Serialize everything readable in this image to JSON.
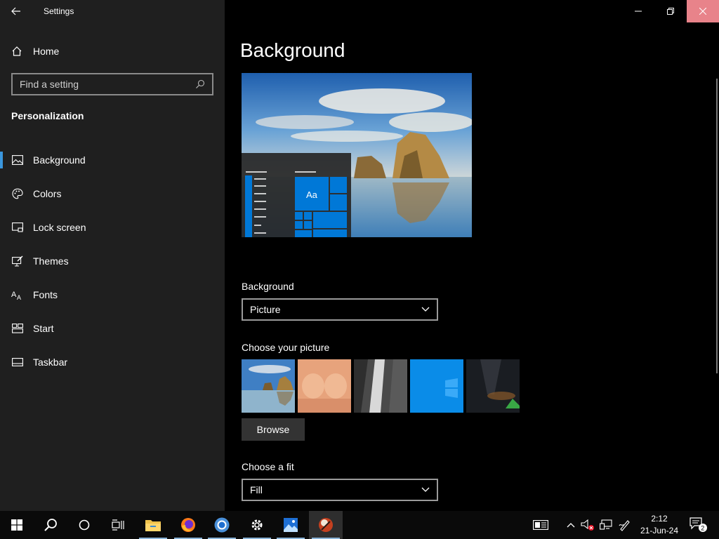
{
  "window": {
    "title": "Settings",
    "controls": [
      "minimize",
      "restore",
      "close"
    ]
  },
  "sidebar": {
    "home_label": "Home",
    "search_placeholder": "Find a setting",
    "section_title": "Personalization",
    "items": [
      {
        "label": "Background",
        "icon": "picture-icon",
        "active": true
      },
      {
        "label": "Colors",
        "icon": "palette-icon",
        "active": false
      },
      {
        "label": "Lock screen",
        "icon": "lock-screen-icon",
        "active": false
      },
      {
        "label": "Themes",
        "icon": "themes-icon",
        "active": false
      },
      {
        "label": "Fonts",
        "icon": "fonts-icon",
        "active": false
      },
      {
        "label": "Start",
        "icon": "start-icon",
        "active": false
      },
      {
        "label": "Taskbar",
        "icon": "taskbar-icon",
        "active": false
      }
    ]
  },
  "main": {
    "page_title": "Background",
    "preview_tile_text": "Aa",
    "background_label": "Background",
    "background_value": "Picture",
    "choose_picture_label": "Choose your picture",
    "pictures": [
      "beach-rock",
      "portrait",
      "waterfall",
      "windows-blue",
      "night-sky"
    ],
    "browse_label": "Browse",
    "fit_label": "Choose a fit",
    "fit_value": "Fill"
  },
  "taskbar": {
    "apps": [
      "start",
      "search",
      "cortana",
      "task-view",
      "file-explorer",
      "firefox",
      "chrome",
      "settings",
      "photos",
      "app"
    ],
    "clock_time": "2:12",
    "clock_date": "21-Jun-24",
    "notification_count": "2"
  },
  "colors": {
    "accent": "#0078d7",
    "sidebar_bg": "#1f1f1f",
    "close_hover": "#e8838a"
  }
}
